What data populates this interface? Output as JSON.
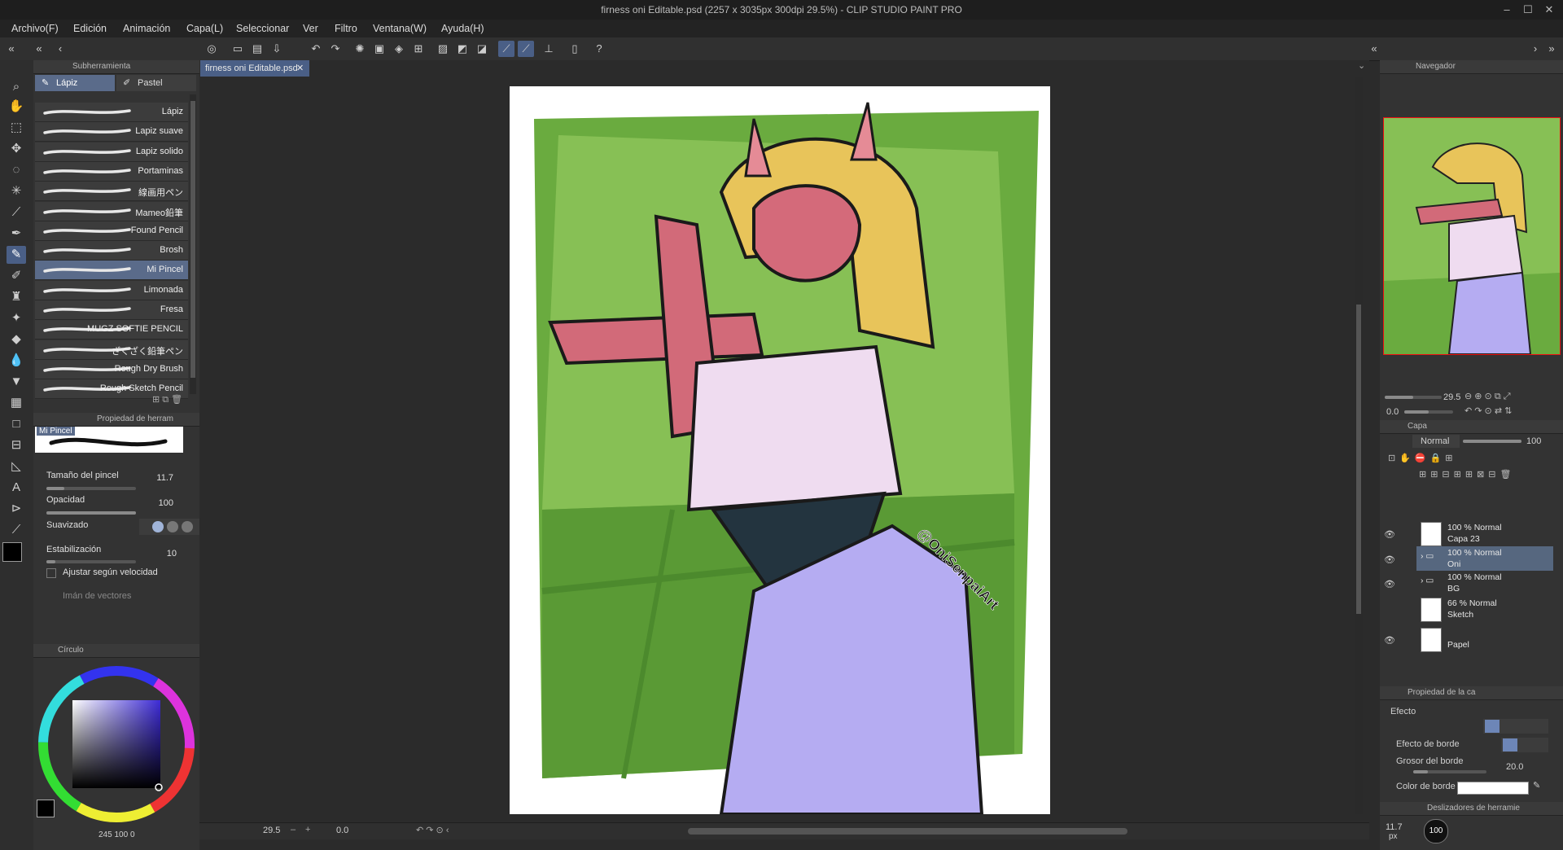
{
  "window": {
    "title": "firness oni Editable.psd (2257 x 3035px 300dpi 29.5%) - CLIP STUDIO PAINT PRO",
    "controls": [
      "–",
      "☐",
      "✕"
    ]
  },
  "menu": {
    "items": [
      "Archivo(F)",
      "Edición",
      "Animación",
      "Capa(L)",
      "Seleccionar",
      "Ver",
      "Filtro",
      "Ventana(W)",
      "Ayuda(H)"
    ]
  },
  "subtool_panel": {
    "title": "Subherramienta",
    "tabs": [
      "Lápiz",
      "Pastel"
    ],
    "brushes": [
      "Lápiz",
      "Lapiz suave",
      "Lapiz solido",
      "Portaminas",
      "線画用ペン",
      "Mameo鉛筆",
      "Found Pencil",
      "Brosh",
      "Mi Pincel",
      "Limonada",
      "Fresa",
      "MUGZ SOFTIE PENCIL",
      "ざくざく鉛筆ペン",
      "Rough Dry Brush",
      "Rough Sketch Pencil"
    ],
    "selected_brush": "Mi Pincel"
  },
  "tool_property": {
    "title": "Propiedad de herram",
    "preset_name": "Mi Pincel",
    "brush_size_label": "Tamaño del pincel",
    "brush_size_value": "11.7",
    "opacity_label": "Opacidad",
    "opacity_value": "100",
    "smoothing_label": "Suavizado",
    "stabilization_label": "Estabilización",
    "stabilization_value": "10",
    "speed_label": "Ajustar según velocidad",
    "vector_label": "Imán de vectores"
  },
  "color_panel": {
    "title": "Círculo",
    "hue_color": "#3d2bd6",
    "main_color": "#000000",
    "sub_color": "#ffffff",
    "readout": "245",
    "readout2": "100",
    "readout3": "0"
  },
  "document": {
    "tab_label": "firness oni Editable.psd",
    "watermark": "@OniSenpaiArt"
  },
  "status": {
    "zoom": "29.5",
    "angle": "0.0"
  },
  "navigator": {
    "title": "Navegador",
    "zoom": "29.5",
    "angle": "0.0"
  },
  "layers_panel": {
    "title": "Capa",
    "blend_mode": "Normal",
    "opacity": "100",
    "layers": [
      {
        "name": "Capa 23",
        "mode": "100 % Normal",
        "visible": true,
        "selected": false,
        "folder": false
      },
      {
        "name": "Oni",
        "mode": "100 % Normal",
        "visible": true,
        "selected": true,
        "folder": true
      },
      {
        "name": "BG",
        "mode": "100 % Normal",
        "visible": true,
        "selected": false,
        "folder": true
      },
      {
        "name": "Sketch",
        "mode": "66 % Normal",
        "visible": false,
        "selected": false,
        "folder": false
      },
      {
        "name": "Papel",
        "mode": "",
        "visible": true,
        "selected": false,
        "folder": false
      }
    ]
  },
  "layer_property": {
    "title": "Propiedad de la ca",
    "effect_label": "Efecto",
    "border_effect_label": "Efecto de borde",
    "border_width_label": "Grosor del borde",
    "border_width_value": "20.0",
    "border_color_label": "Color de borde"
  },
  "bottom_right": {
    "tool_sliders_title": "Deslizadores de herramie",
    "brush_size": "11.7",
    "unit": "px",
    "opacity": "100"
  },
  "colors": {
    "accent": "#4a5f86",
    "panel": "#333333",
    "canvas_bg": "#2b2b2b"
  }
}
